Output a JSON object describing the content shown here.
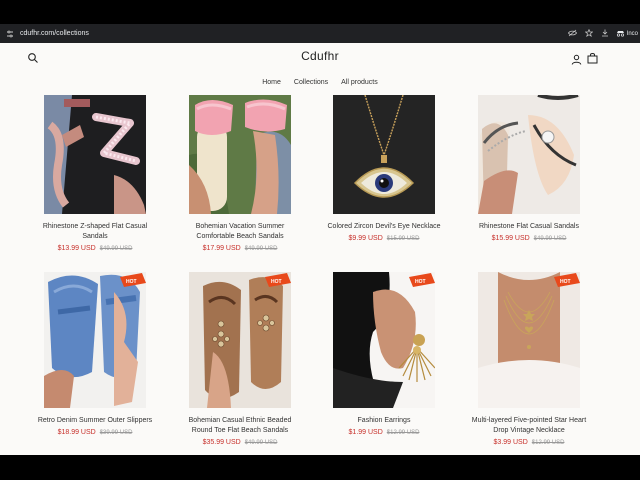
{
  "browser": {
    "url": "cdufhr.com/collections",
    "incognito_label": "Inco"
  },
  "store": {
    "name": "Cdufhr"
  },
  "nav": {
    "items": [
      "Home",
      "Collections",
      "All products"
    ]
  },
  "badge": {
    "text": "HOT"
  },
  "products": [
    {
      "title": "Rhinestone Z-shaped Flat Casual Sandals",
      "price": "$13.99 USD",
      "compare_price": "$49.99 USD"
    },
    {
      "title": "Bohemian Vacation Summer Comfortable Beach Sandals",
      "price": "$17.99 USD",
      "compare_price": "$49.99 USD"
    },
    {
      "title": "Colored Zircon Devil's Eye Necklace",
      "price": "$9.99 USD",
      "compare_price": "$15.99 USD"
    },
    {
      "title": "Rhinestone Flat Casual Sandals",
      "price": "$15.99 USD",
      "compare_price": "$49.99 USD"
    },
    {
      "title": "Retro Denim Summer Outer Slippers",
      "price": "$18.99 USD",
      "compare_price": "$39.99 USD"
    },
    {
      "title": "Bohemian Casual Ethnic Beaded Round Toe Flat Beach Sandals",
      "price": "$35.99 USD",
      "compare_price": "$49.99 USD"
    },
    {
      "title": "Fashion Earrings",
      "price": "$1.99 USD",
      "compare_price": "$12.99 USD"
    },
    {
      "title": "Multi-layered Five-pointed Star Heart Drop Vintage Necklace",
      "price": "$3.99 USD",
      "compare_price": "$12.99 USD"
    }
  ]
}
